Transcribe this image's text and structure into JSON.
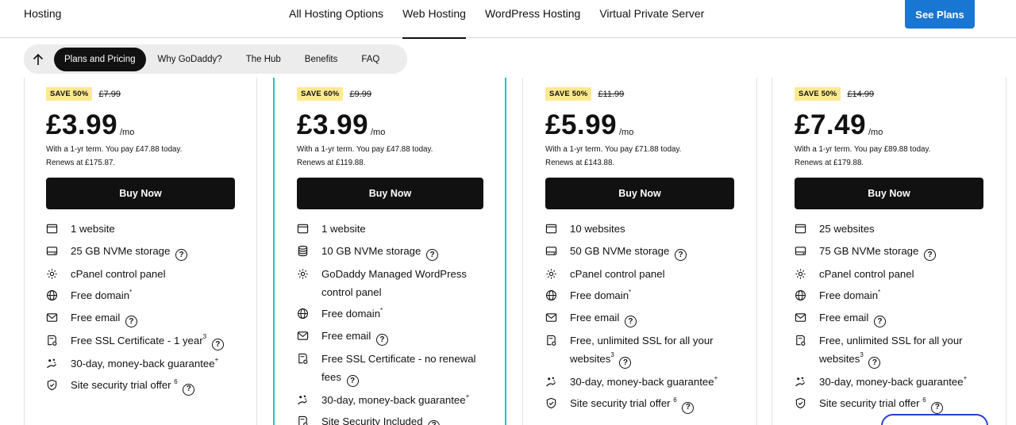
{
  "topnav": {
    "brand": "Hosting",
    "links": [
      "All Hosting Options",
      "Web Hosting",
      "WordPress Hosting",
      "Virtual Private Server"
    ],
    "cta": "See Plans"
  },
  "subnav": {
    "items": [
      "Plans and Pricing",
      "Why GoDaddy?",
      "The Hub",
      "Benefits",
      "FAQ"
    ]
  },
  "plans": [
    {
      "save": "SAVE 50%",
      "orig": "£7.99",
      "price": "£3.99",
      "per": "/mo",
      "note1": "With a 1-yr term. You pay £47.88 today.",
      "note2": "Renews at £175.87.",
      "buy": "Buy Now",
      "features": [
        {
          "icon": "website-icon",
          "text": "1 website"
        },
        {
          "icon": "storage-icon",
          "text": "25 GB NVMe storage",
          "help": "?"
        },
        {
          "icon": "control-panel-icon",
          "text": "cPanel control panel"
        },
        {
          "icon": "globe-icon",
          "text": "Free domain",
          "sup": "*"
        },
        {
          "icon": "email-icon",
          "text": "Free email",
          "help": "?"
        },
        {
          "icon": "ssl-icon",
          "text": "Free SSL Certificate - 1 year",
          "sup": "3",
          "help": "?"
        },
        {
          "icon": "guarantee-icon",
          "text": "30-day, money-back guarantee",
          "sup": "+"
        },
        {
          "icon": "shield-icon",
          "text": "Site security trial offer ",
          "sup": "6",
          "help": "?"
        }
      ]
    },
    {
      "save": "SAVE 60%",
      "orig": "£9.99",
      "price": "£3.99",
      "per": "/mo",
      "note1": "With a 1-yr term. You pay £47.88 today.",
      "note2": "Renews at £119.88.",
      "buy": "Buy Now",
      "features": [
        {
          "icon": "website-icon",
          "text": "1 website"
        },
        {
          "icon": "database-icon",
          "text": "10 GB NVMe storage",
          "help": "?"
        },
        {
          "icon": "control-panel-icon",
          "text": "GoDaddy Managed WordPress control panel"
        },
        {
          "icon": "globe-icon",
          "text": "Free domain",
          "sup": "*"
        },
        {
          "icon": "email-icon",
          "text": "Free email",
          "help": "?"
        },
        {
          "icon": "ssl-icon",
          "text": "Free SSL Certificate - no renewal fees",
          "help": "?"
        },
        {
          "icon": "guarantee-icon",
          "text": "30-day, money-back guarantee",
          "sup": "+"
        },
        {
          "icon": "ssl-icon",
          "text": "Site Security Included",
          "help": "?"
        }
      ]
    },
    {
      "save": "SAVE 50%",
      "orig": "£11.99",
      "price": "£5.99",
      "per": "/mo",
      "note1": "With a 1-yr term. You pay £71.88 today.",
      "note2": "Renews at £143.88.",
      "buy": "Buy Now",
      "features": [
        {
          "icon": "website-icon",
          "text": "10 websites"
        },
        {
          "icon": "storage-icon",
          "text": "50 GB NVMe storage",
          "help": "?"
        },
        {
          "icon": "control-panel-icon",
          "text": "cPanel control panel"
        },
        {
          "icon": "globe-icon",
          "text": "Free domain",
          "sup": "*"
        },
        {
          "icon": "email-icon",
          "text": "Free email",
          "help": "?"
        },
        {
          "icon": "ssl-icon",
          "text": "Free, unlimited SSL for all your websites",
          "sup": "3",
          "help": "?"
        },
        {
          "icon": "guarantee-icon",
          "text": "30-day, money-back guarantee",
          "sup": "+"
        },
        {
          "icon": "shield-icon",
          "text": "Site security trial offer ",
          "sup": "6",
          "help": "?"
        }
      ]
    },
    {
      "save": "SAVE 50%",
      "orig": "£14.99",
      "price": "£7.49",
      "per": "/mo",
      "note1": "With a 1-yr term. You pay £89.88 today.",
      "note2": "Renews at £179.88.",
      "buy": "Buy Now",
      "features": [
        {
          "icon": "website-icon",
          "text": "25 websites"
        },
        {
          "icon": "storage-icon",
          "text": "75 GB NVMe storage",
          "help": "?"
        },
        {
          "icon": "control-panel-icon",
          "text": "cPanel control panel"
        },
        {
          "icon": "globe-icon",
          "text": "Free domain",
          "sup": "*"
        },
        {
          "icon": "email-icon",
          "text": "Free email",
          "help": "?"
        },
        {
          "icon": "ssl-icon",
          "text": "Free, unlimited SSL for all your websites",
          "sup": "3",
          "help": "?"
        },
        {
          "icon": "guarantee-icon",
          "text": "30-day, money-back guarantee",
          "sup": "+"
        },
        {
          "icon": "shield-icon",
          "text": "Site security trial offer ",
          "sup": "6",
          "help": "?"
        }
      ]
    }
  ]
}
